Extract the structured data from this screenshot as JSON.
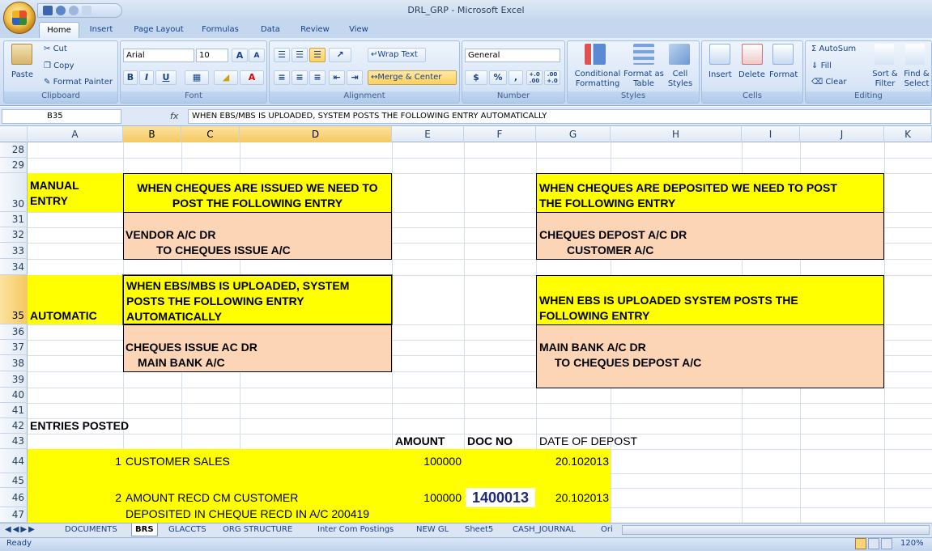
{
  "window": {
    "title": "DRL_GRP - Microsoft Excel"
  },
  "ribbon": {
    "tabs": [
      "Home",
      "Insert",
      "Page Layout",
      "Formulas",
      "Data",
      "Review",
      "View"
    ],
    "clipboard": {
      "paste": "Paste",
      "cut": "Cut",
      "copy": "Copy",
      "format_painter": "Format Painter",
      "label": "Clipboard"
    },
    "font": {
      "name": "Arial",
      "size": "10",
      "label": "Font"
    },
    "alignment": {
      "wrap": "Wrap Text",
      "merge": "Merge & Center",
      "label": "Alignment"
    },
    "number": {
      "format": "General",
      "currency": "$",
      "percent": "%",
      "comma": ",",
      "inc": "+.0 .00",
      "dec": ".00 +.0",
      "label": "Number"
    },
    "styles": {
      "conditional": "Conditional Formatting",
      "format_table": "Format as Table",
      "cell_styles": "Cell Styles",
      "label": "Styles"
    },
    "cells": {
      "insert": "Insert",
      "delete": "Delete",
      "format": "Format",
      "label": "Cells"
    },
    "editing": {
      "autosum": "AutoSum",
      "fill": "Fill",
      "clear": "Clear",
      "sort": "Sort & Filter",
      "find": "Find & Select",
      "label": "Editing"
    }
  },
  "formula_bar": {
    "name_box": "B35",
    "fx": "fx",
    "content": "WHEN EBS/MBS IS UPLOADED, SYSTEM POSTS THE FOLLOWING ENTRY AUTOMATICALLY"
  },
  "columns": [
    "A",
    "B",
    "C",
    "D",
    "E",
    "F",
    "G",
    "H",
    "I",
    "J",
    "K"
  ],
  "rows": [
    "28",
    "29",
    "30",
    "31",
    "32",
    "33",
    "34",
    "35",
    "36",
    "37",
    "38",
    "39",
    "40",
    "41",
    "42",
    "43",
    "44",
    "45",
    "46",
    "47"
  ],
  "cells": {
    "a30": "MANUAL\nENTRY",
    "b30": "WHEN CHEQUES ARE ISSUED WE NEED TO\nPOST THE FOLLOWING ENTRY",
    "g30": "WHEN CHEQUES ARE DEPOSITED WE NEED TO POST\nTHE FOLLOWING ENTRY",
    "b32": "VENDOR A/C DR",
    "b33": "TO CHEQUES ISSUE A/C",
    "g32": "CHEQUES DEPOST A/C DR",
    "g33": "CUSTOMER A/C",
    "b35": "WHEN EBS/MBS IS UPLOADED, SYSTEM\nPOSTS THE FOLLOWING ENTRY\nAUTOMATICALLY",
    "a35": "AUTOMATIC",
    "g35": "WHEN EBS IS UPLOADED SYSTEM POSTS THE\nFOLLOWING ENTRY",
    "b37": "CHEQUES ISSUE AC DR",
    "b38": "MAIN BANK A/C",
    "g37": "MAIN BANK A/C DR",
    "g38": "TO CHEQUES DEPOST A/C",
    "a42": "ENTRIES POSTED",
    "e43": "AMOUNT",
    "f43": "DOC NO",
    "g43": "DATE OF DEPOST",
    "a44": "1",
    "b44": "CUSTOMER SALES",
    "e44": "100000",
    "g44": "20.102013",
    "a46": "2",
    "b46": "AMOUNT RECD CM CUSTOMER",
    "e46": "100000",
    "f46": "1400013",
    "g46": "20.102013",
    "b47": "DEPOSITED IN  CHEQUE RECD IN A/C 200419"
  },
  "sheet_tabs": [
    "DOCUMENTS",
    "BRS",
    "GLACCTS",
    "ORG STRUCTURE",
    "Inter Com Postings",
    "NEW GL",
    "Sheet5",
    "CASH_JOURNAL",
    "Ori"
  ],
  "active_sheet": "BRS",
  "status": {
    "ready": "Ready",
    "zoom": "120%"
  },
  "colors": {
    "yellow": "#ffff00",
    "peach": "#fbd5b5",
    "ribbon": "#dbe7f7"
  }
}
